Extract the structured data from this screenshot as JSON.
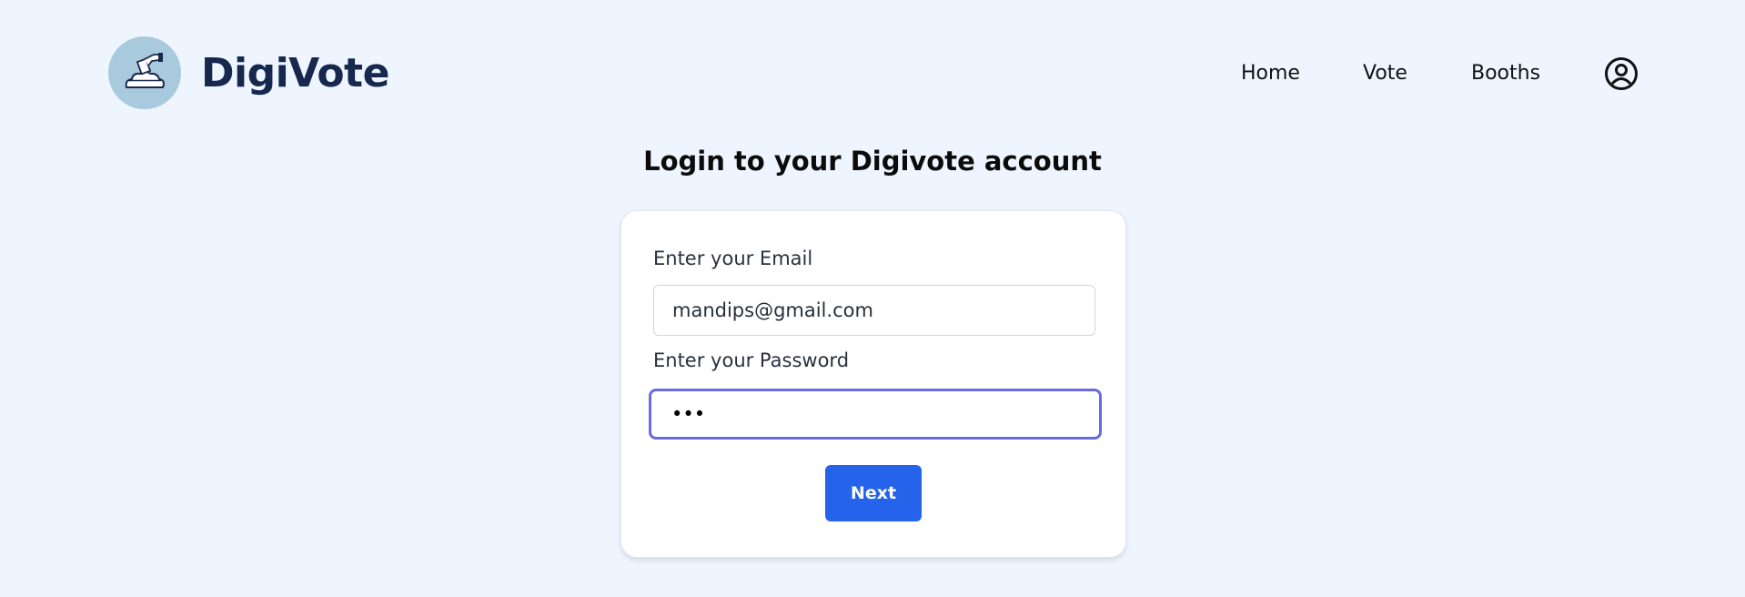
{
  "brand": {
    "name": "DigiVote",
    "logo_icon": "ballot-box-hand-icon"
  },
  "nav": {
    "items": [
      {
        "label": "Home"
      },
      {
        "label": "Vote"
      },
      {
        "label": "Booths"
      }
    ],
    "profile_icon": "user-circle-icon"
  },
  "login": {
    "title": "Login to your Digivote account",
    "email_label": "Enter your Email",
    "email_value": "mandips@gmail.com",
    "password_label": "Enter your Password",
    "password_value": "•••",
    "submit_label": "Next"
  },
  "colors": {
    "background": "#eef5ff",
    "brand_text": "#17284f",
    "logo_circle": "#a9c9dd",
    "primary_button": "#2563eb",
    "focus_ring": "#6a6be0"
  }
}
